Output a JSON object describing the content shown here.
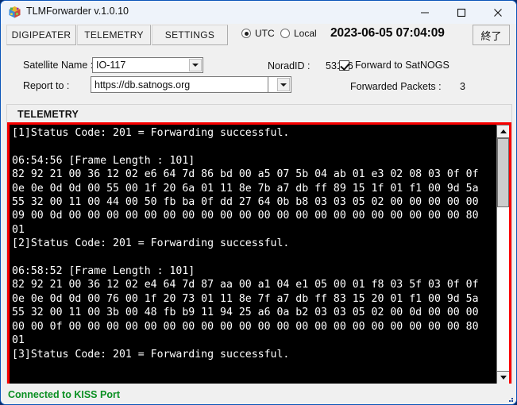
{
  "window": {
    "title": "TLMForwarder v.1.0.10",
    "app_icon": "cube-icon",
    "minimize": "minimize-icon",
    "maximize": "maximize-icon",
    "close": "close-icon"
  },
  "tabs": [
    {
      "label": "DIGIPEATER"
    },
    {
      "label": "TELEMETRY"
    },
    {
      "label": "SETTINGS"
    }
  ],
  "time_mode": {
    "utc_label": "UTC",
    "local_label": "Local",
    "selected": "UTC",
    "clock": "2023-06-05 07:04:09"
  },
  "quit_button": {
    "label": "終了"
  },
  "form": {
    "satellite_label": "Satellite Name :",
    "satellite_value": "IO-117",
    "norad_label": "NoradID :",
    "norad_value": "53106",
    "report_label": "Report to :",
    "report_value": "https://db.satnogs.org",
    "report_extra_value": "",
    "forward_checkbox_label": "Forward to SatNOGS",
    "forward_checkbox_checked": true,
    "forwarded_packets_label": "Forwarded Packets :",
    "forwarded_packets_value": "3"
  },
  "telemetry": {
    "group_title": "TELEMETRY",
    "border_color": "#f90000",
    "background_color": "#000000",
    "text_color": "#ffffff",
    "log": "[1]Status Code: 201 = Forwarding successful.\n\n06:54:56 [Frame Length : 101]\n82 92 21 00 36 12 02 e6 64 7d 86 bd 00 a5 07 5b 04 ab 01 e3 02 08 03 0f 0f\n0e 0e 0d 0d 00 55 00 1f 20 6a 01 11 8e 7b a7 db ff 89 15 1f 01 f1 00 9d 5a\n55 32 00 11 00 44 00 50 fb ba 0f dd 27 64 0b b8 03 03 05 02 00 00 00 00 00\n09 00 0d 00 00 00 00 00 00 00 00 00 00 00 00 00 00 00 00 00 00 00 00 00 80\n01\n[2]Status Code: 201 = Forwarding successful.\n\n06:58:52 [Frame Length : 101]\n82 92 21 00 36 12 02 e4 64 7d 87 aa 00 a1 04 e1 05 00 01 f8 03 5f 03 0f 0f\n0e 0e 0d 0d 00 76 00 1f 20 73 01 11 8e 7f a7 db ff 83 15 20 01 f1 00 9d 5a\n55 32 00 11 00 3b 00 48 fb b9 11 94 25 a6 0a b2 03 03 05 02 00 0d 00 00 00\n00 00 0f 00 00 00 00 00 00 00 00 00 00 00 00 00 00 00 00 00 00 00 00 00 80\n01\n[3]Status Code: 201 = Forwarding successful.\n",
    "scrollbar": {
      "up_arrow": "scroll-up-icon",
      "down_arrow": "scroll-down-icon"
    }
  },
  "status": {
    "message": "Connected to KISS Port",
    "color": "#0a8f22"
  }
}
